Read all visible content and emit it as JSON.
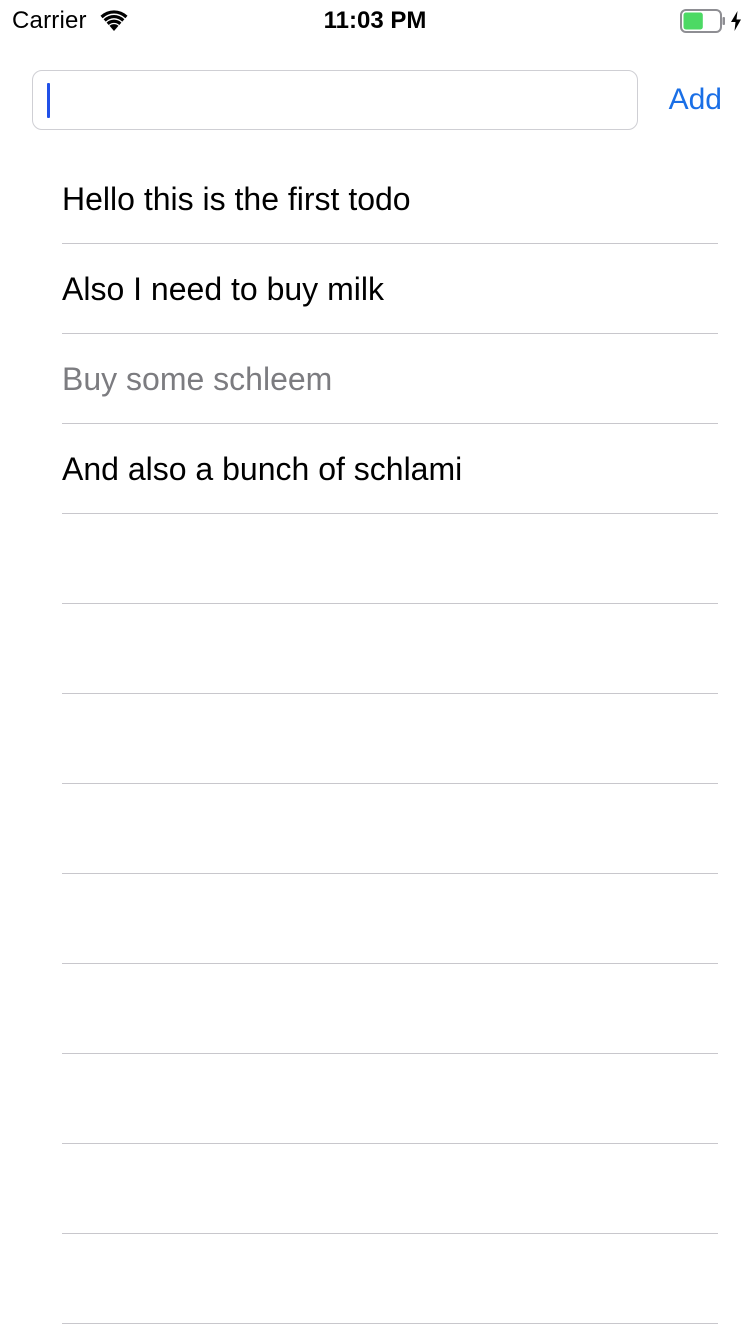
{
  "status_bar": {
    "carrier": "Carrier",
    "time": "11:03 PM",
    "battery_level": 0.55,
    "charging": true,
    "wifi_icon": "wifi-icon",
    "battery_icon": "battery-icon",
    "charging_icon": "charging-bolt-icon"
  },
  "entry": {
    "input_value": "",
    "input_placeholder": "",
    "add_label": "Add"
  },
  "todos": [
    {
      "text": "Hello this is the first todo",
      "done": false
    },
    {
      "text": "Also I need to buy milk",
      "done": false
    },
    {
      "text": "Buy some schleem",
      "done": true
    },
    {
      "text": "And also a bunch of schlami",
      "done": false
    },
    {
      "text": "",
      "done": false
    },
    {
      "text": "",
      "done": false
    },
    {
      "text": "",
      "done": false
    },
    {
      "text": "",
      "done": false
    },
    {
      "text": "",
      "done": false
    },
    {
      "text": "",
      "done": false
    },
    {
      "text": "",
      "done": false
    },
    {
      "text": "",
      "done": false
    },
    {
      "text": "",
      "done": false
    }
  ],
  "colors": {
    "accent": "#1a6fe6",
    "caret": "#2050e8",
    "done_text": "#7c7c80",
    "separator": "#c8c7cc",
    "battery_fill": "#4cd964"
  }
}
